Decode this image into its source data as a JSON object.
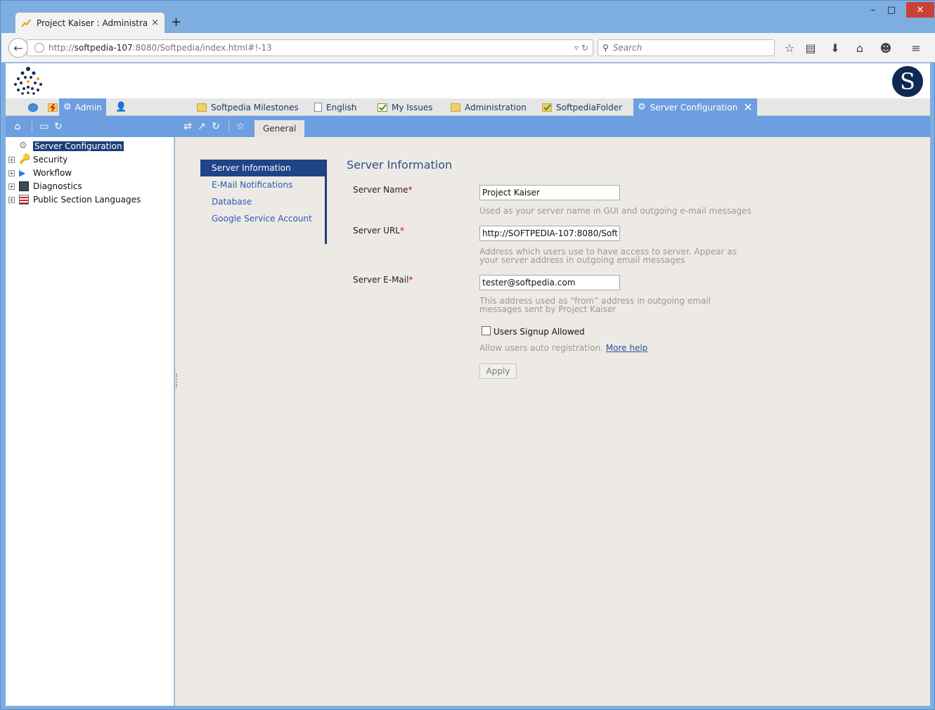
{
  "browser": {
    "tab_title": "Project Kaiser : Administrat...",
    "tab_close": "×",
    "new_tab": "+",
    "win_min": "–",
    "win_max": "□",
    "win_close": "✕",
    "url_prefix": "http://",
    "url_host": "softpedia-107",
    "url_rest": ":8080/Softpedia/index.html#!-13",
    "search_placeholder": "Search"
  },
  "app": {
    "brand_letter": "S",
    "top_tabs": [
      {
        "label": "Admin"
      },
      {
        "label": "Softpedia Milestones"
      },
      {
        "label": "English"
      },
      {
        "label": "My Issues"
      },
      {
        "label": "Administration"
      },
      {
        "label": "SoftpediaFolder"
      },
      {
        "label": "Server Configuration"
      }
    ],
    "general_tab": "General"
  },
  "tree": {
    "items": [
      {
        "label": "Server Configuration"
      },
      {
        "label": "Security"
      },
      {
        "label": "Workflow"
      },
      {
        "label": "Diagnostics"
      },
      {
        "label": "Public Section Languages"
      }
    ]
  },
  "sidenav": {
    "items": [
      {
        "label": "Server Information"
      },
      {
        "label": "E-Mail Notifications"
      },
      {
        "label": "Database"
      },
      {
        "label": "Google Service Account"
      }
    ]
  },
  "form": {
    "title": "Server Information",
    "server_name_label": "Server Name",
    "server_name_value": "Project Kaiser",
    "server_name_hint": "Used as your server name in GUI and outgoing e-mail messages",
    "server_url_label": "Server URL",
    "server_url_value": "http://SOFTPEDIA-107:8080/Softp",
    "server_url_hint": "Address which users use to have access to server. Appear as your server address in outgoing email messages",
    "server_email_label": "Server E-Mail",
    "server_email_value": "tester@softpedia.com",
    "server_email_hint": "This address used as “from” address in outgoing email messages sent by Project Kaiser",
    "signup_label": "Users Signup Allowed",
    "signup_checked": false,
    "signup_hint": "Allow users auto registration.",
    "more_help": "More help",
    "apply_label": "Apply",
    "required_mark": "*"
  }
}
